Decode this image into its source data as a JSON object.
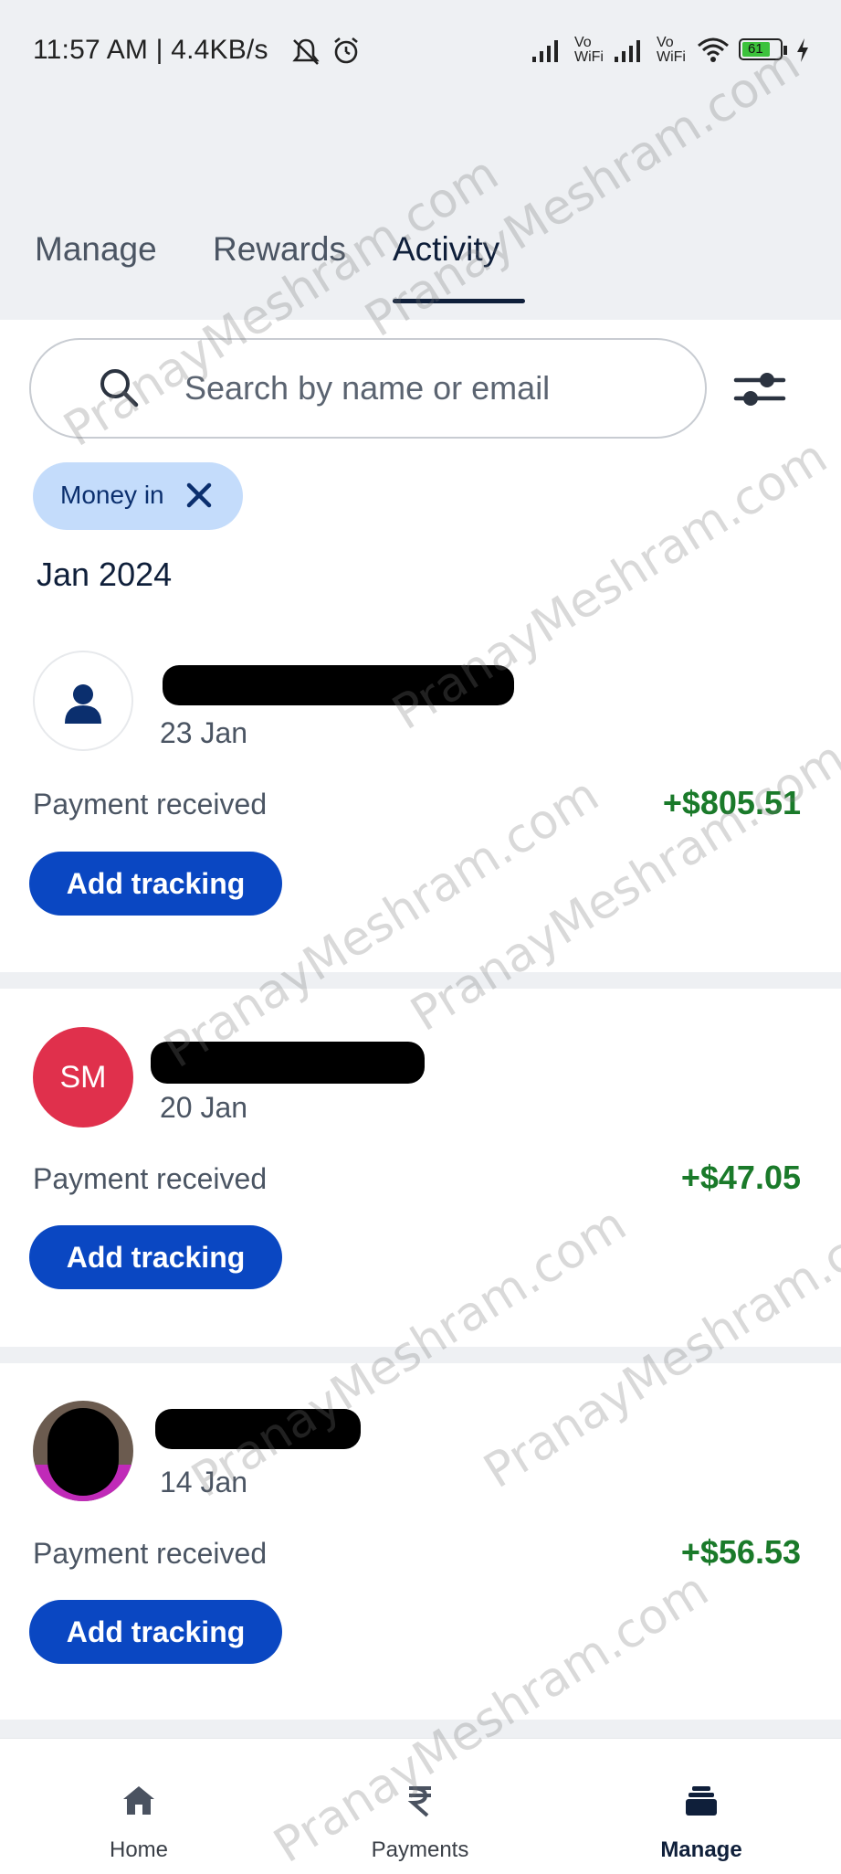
{
  "status_bar": {
    "time_and_speed": "11:57 AM | 4.4KB/s",
    "network_1": "Vo WiFi",
    "network_2": "Vo WiFi",
    "battery": "61"
  },
  "tabs": [
    {
      "label": "Manage",
      "active": false
    },
    {
      "label": "Rewards",
      "active": false
    },
    {
      "label": "Activity",
      "active": true
    }
  ],
  "search": {
    "placeholder": "Search by name or email"
  },
  "filter_chip": {
    "label": "Money in"
  },
  "month_header": "Jan 2024",
  "transactions": [
    {
      "avatar_type": "generic-person-icon",
      "initials": "",
      "date": "23 Jan",
      "description": "Payment received",
      "amount": "+$805.51",
      "button": "Add tracking"
    },
    {
      "avatar_type": "initials",
      "initials": "SM",
      "date": "20 Jan",
      "description": "Payment received",
      "amount": "+$47.05",
      "button": "Add tracking"
    },
    {
      "avatar_type": "photo",
      "initials": "",
      "date": "14 Jan",
      "description": "Payment received",
      "amount": "+$56.53",
      "button": "Add tracking"
    }
  ],
  "bottom_nav": [
    {
      "label": "Home",
      "icon": "home-icon",
      "active": false
    },
    {
      "label": "Payments",
      "icon": "rupee-icon",
      "active": false
    },
    {
      "label": "Manage",
      "icon": "wallet-icon",
      "active": true
    }
  ],
  "watermark": "PranayMeshram.com",
  "colors": {
    "accent_blue": "#0a47c2",
    "chip_bg": "#c4dcfb",
    "amount_green": "#1a7a2a",
    "initials_avatar": "#e0304c"
  }
}
